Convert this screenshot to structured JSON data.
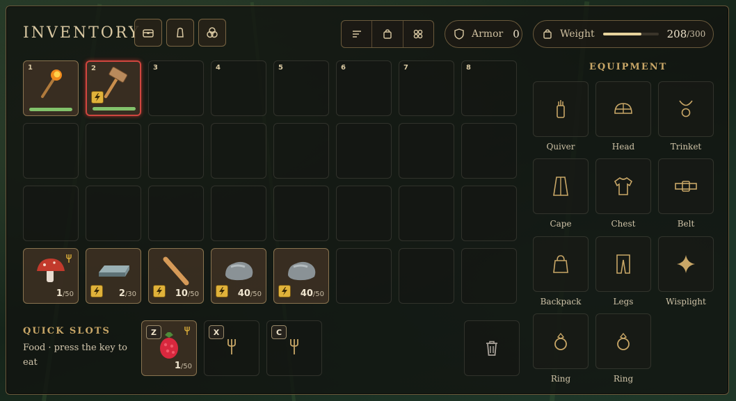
{
  "header": {
    "title": "INVENTORY",
    "tab_icons": [
      "chest-icon",
      "backpack-icon",
      "circles-icon"
    ],
    "view_icons": [
      "sort-icon",
      "bag-icon",
      "grid-icon"
    ],
    "armor": {
      "label": "Armor",
      "value": "0"
    },
    "weight": {
      "label": "Weight",
      "current": "208",
      "max": "/300",
      "fill_fraction": 0.69
    }
  },
  "slots": [
    {
      "num": "1",
      "item": "torch",
      "durability": 1.0
    },
    {
      "num": "2",
      "item": "hammer",
      "durability": 1.0,
      "selected": true,
      "bolt": true
    },
    {
      "num": "3"
    },
    {
      "num": "4"
    },
    {
      "num": "5"
    },
    {
      "num": "6"
    },
    {
      "num": "7"
    },
    {
      "num": "8"
    }
  ],
  "stacks": [
    {
      "item": "mushroom",
      "count": "1",
      "max": "/50",
      "food": true
    },
    {
      "item": "metal-bar",
      "count": "2",
      "max": "/30",
      "bolt": true
    },
    {
      "item": "wood-stick",
      "count": "10",
      "max": "/50",
      "bolt": true
    },
    {
      "item": "stone",
      "count": "40",
      "max": "/50",
      "bolt": true
    },
    {
      "item": "stone",
      "count": "40",
      "max": "/50",
      "bolt": true
    }
  ],
  "equipment": {
    "title": "EQUIPMENT",
    "slots": [
      "Quiver",
      "Head",
      "Trinket",
      "Cape",
      "Chest",
      "Belt",
      "Backpack",
      "Legs",
      "Wisplight",
      "Ring",
      "Ring"
    ]
  },
  "quick_slots": {
    "title": "QUICK SLOTS",
    "hint": "Food · press the key to eat",
    "slots": [
      {
        "key": "Z",
        "item": "raspberry",
        "count": "1",
        "max": "/50"
      },
      {
        "key": "X"
      },
      {
        "key": "C"
      }
    ]
  },
  "colors": {
    "accent": "#c9a767",
    "selected_border": "#d0463f",
    "durability": "#82c26b",
    "bolt": "#e0b23a"
  }
}
